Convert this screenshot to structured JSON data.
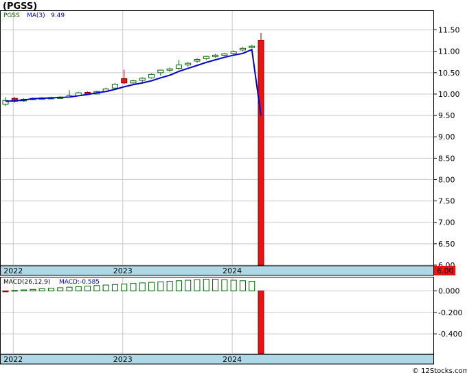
{
  "chart_data": {
    "type": "candlestick",
    "title": "(PGSS)",
    "x_labels": [
      "2022",
      "2023",
      "2024"
    ],
    "price_panel": {
      "legend": {
        "symbol": "PGSS",
        "ma_label": "MA(3)",
        "ma_value": "9.49"
      },
      "y_ticks": [
        "11.50",
        "11.00",
        "10.50",
        "10.00",
        "9.50",
        "9.00",
        "8.50",
        "8.00",
        "7.50",
        "7.00",
        "6.50",
        "6.00"
      ],
      "last_price_tag": "6.00",
      "ylim": [
        6.0,
        11.75
      ],
      "candles": [
        {
          "o": 9.76,
          "h": 9.93,
          "l": 9.72,
          "c": 9.85
        },
        {
          "o": 9.9,
          "h": 9.93,
          "l": 9.8,
          "c": 9.83
        },
        {
          "o": 9.84,
          "h": 9.9,
          "l": 9.82,
          "c": 9.88
        },
        {
          "o": 9.88,
          "h": 9.92,
          "l": 9.86,
          "c": 9.9
        },
        {
          "o": 9.89,
          "h": 9.93,
          "l": 9.87,
          "c": 9.91
        },
        {
          "o": 9.9,
          "h": 9.94,
          "l": 9.88,
          "c": 9.92
        },
        {
          "o": 9.91,
          "h": 9.95,
          "l": 9.89,
          "c": 9.93
        },
        {
          "o": 9.93,
          "h": 10.09,
          "l": 9.92,
          "c": 9.96
        },
        {
          "o": 9.96,
          "h": 10.05,
          "l": 9.95,
          "c": 10.03
        },
        {
          "o": 10.04,
          "h": 10.06,
          "l": 9.99,
          "c": 10.0
        },
        {
          "o": 10.0,
          "h": 10.08,
          "l": 9.99,
          "c": 10.06
        },
        {
          "o": 10.06,
          "h": 10.15,
          "l": 10.04,
          "c": 10.12
        },
        {
          "o": 10.14,
          "h": 10.26,
          "l": 10.12,
          "c": 10.23
        },
        {
          "o": 10.36,
          "h": 10.57,
          "l": 10.23,
          "c": 10.26
        },
        {
          "o": 10.26,
          "h": 10.33,
          "l": 10.24,
          "c": 10.31
        },
        {
          "o": 10.32,
          "h": 10.39,
          "l": 10.28,
          "c": 10.37
        },
        {
          "o": 10.38,
          "h": 10.48,
          "l": 10.36,
          "c": 10.46
        },
        {
          "o": 10.5,
          "h": 10.57,
          "l": 10.43,
          "c": 10.56
        },
        {
          "o": 10.57,
          "h": 10.62,
          "l": 10.52,
          "c": 10.59
        },
        {
          "o": 10.6,
          "h": 10.8,
          "l": 10.57,
          "c": 10.68
        },
        {
          "o": 10.68,
          "h": 10.75,
          "l": 10.64,
          "c": 10.72
        },
        {
          "o": 10.77,
          "h": 10.84,
          "l": 10.73,
          "c": 10.81
        },
        {
          "o": 10.83,
          "h": 10.9,
          "l": 10.8,
          "c": 10.88
        },
        {
          "o": 10.88,
          "h": 10.94,
          "l": 10.85,
          "c": 10.91
        },
        {
          "o": 10.91,
          "h": 10.96,
          "l": 10.89,
          "c": 10.94
        },
        {
          "o": 10.95,
          "h": 11.02,
          "l": 10.93,
          "c": 10.99
        },
        {
          "o": 11.03,
          "h": 11.1,
          "l": 11.0,
          "c": 11.07
        },
        {
          "o": 11.1,
          "h": 11.15,
          "l": 11.07,
          "c": 11.12
        },
        {
          "o": 11.26,
          "h": 11.43,
          "l": 6.0,
          "c": 6.0
        }
      ],
      "ma": [
        9.83,
        9.84,
        9.86,
        9.89,
        9.9,
        9.91,
        9.92,
        9.93,
        9.96,
        9.99,
        10.03,
        10.06,
        10.11,
        10.17,
        10.22,
        10.26,
        10.31,
        10.38,
        10.44,
        10.53,
        10.6,
        10.67,
        10.74,
        10.8,
        10.86,
        10.91,
        10.95,
        11.04,
        9.49
      ]
    },
    "macd_panel": {
      "legend": {
        "label": "MACD(26,12,9)",
        "value_label": "MACD:-0.585"
      },
      "y_ticks": [
        "0.000",
        "-0.200",
        "-0.400"
      ],
      "ylim": [
        -0.585,
        0.1
      ],
      "values": [
        -0.008,
        0.005,
        0.01,
        0.015,
        0.02,
        0.025,
        0.03,
        0.035,
        0.04,
        0.045,
        0.05,
        0.055,
        0.06,
        0.065,
        0.07,
        0.075,
        0.08,
        0.085,
        0.09,
        0.095,
        0.1,
        0.105,
        0.11,
        0.11,
        0.105,
        0.1,
        0.095,
        0.09,
        -0.585
      ]
    },
    "colors": {
      "up_candle_fill": "#ffffff",
      "up_candle_stroke": "#006400",
      "down_candle_fill": "#ee1111",
      "down_candle_stroke": "#880000",
      "ma_line": "#0000cc",
      "macd_up_stroke": "#006400",
      "macd_down_fill": "#ee1111",
      "axis_bar": "#aed8e6",
      "grid": "#c8c8c8"
    }
  },
  "watermark": "© 12Stocks.com"
}
